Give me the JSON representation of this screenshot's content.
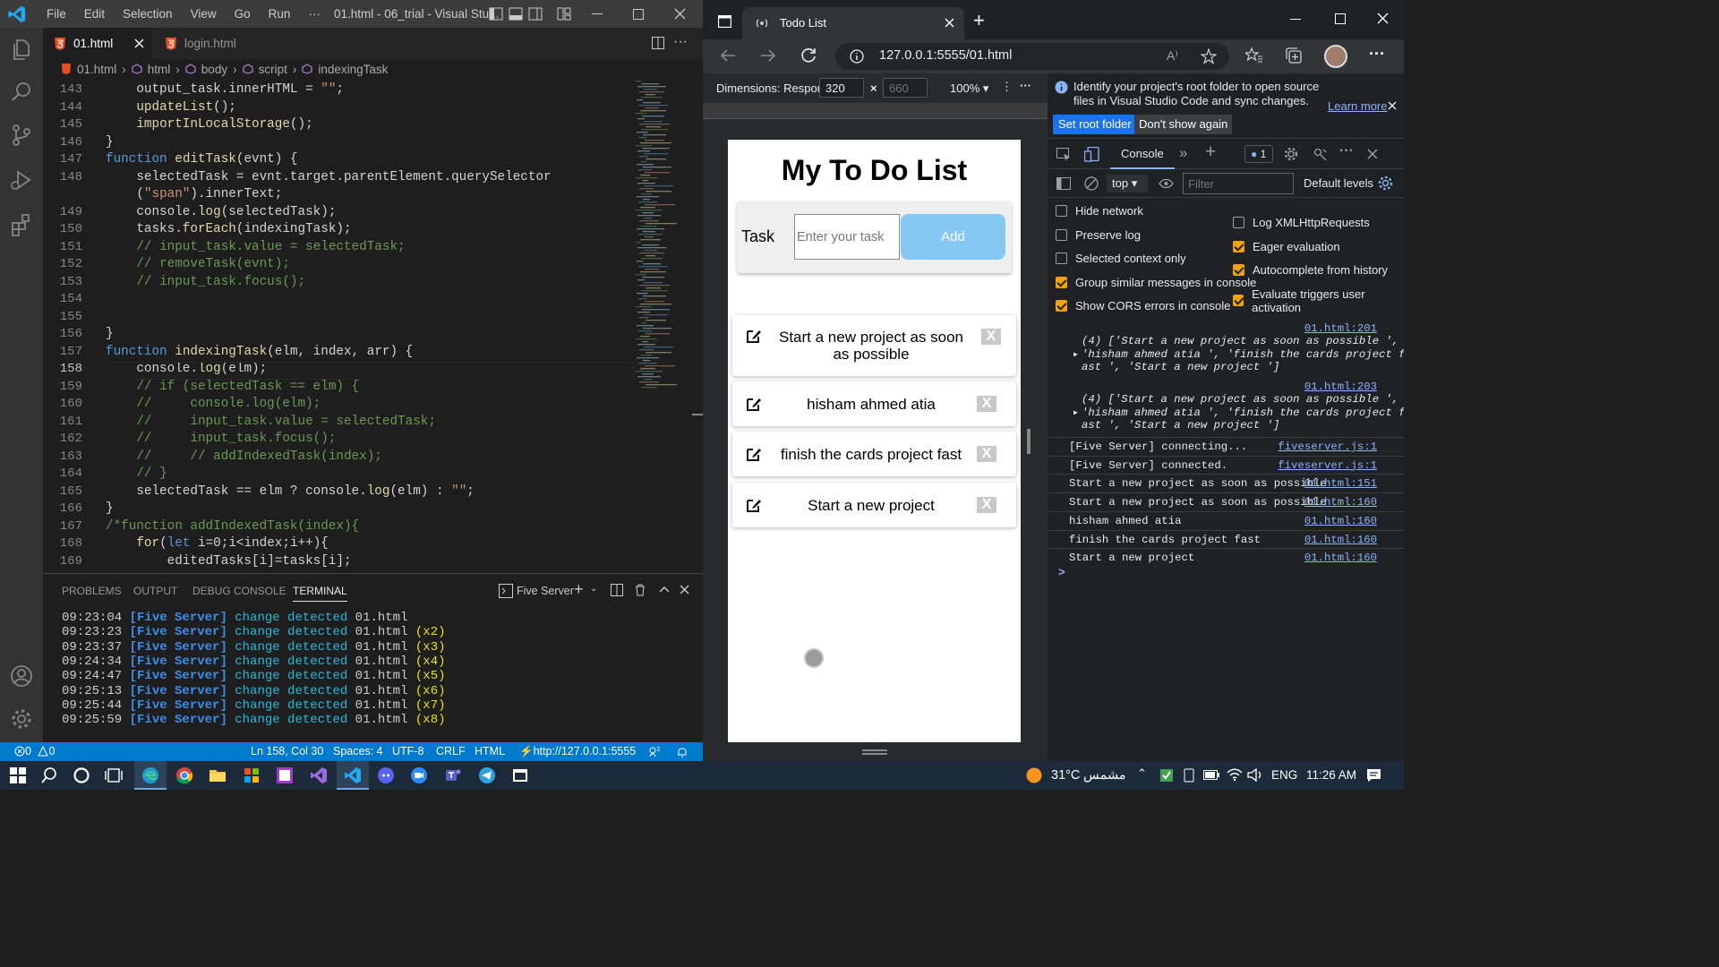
{
  "vscode": {
    "menu": [
      "File",
      "Edit",
      "Selection",
      "View",
      "Go",
      "Run",
      "···"
    ],
    "title": "01.html - 06_trial - Visual Stu...",
    "tabs": [
      {
        "label": "01.html",
        "active": true
      },
      {
        "label": "login.html",
        "active": false
      }
    ],
    "breadcrumb": [
      "01.html",
      "html",
      "body",
      "script",
      "indexingTask"
    ],
    "line_numbers": [
      "143",
      "144",
      "145",
      "146",
      "147",
      "148",
      "",
      "149",
      "150",
      "151",
      "152",
      "153",
      "154",
      "155",
      "156",
      "157",
      "158",
      "159",
      "160",
      "161",
      "162",
      "163",
      "164",
      "165",
      "166",
      "167",
      "168",
      "169"
    ],
    "code": [
      "    output_task.innerHTML = \"\";",
      "    updateList();",
      "    importInLocalStorage();",
      "}",
      "function editTask(evnt) {",
      "    selectedTask = evnt.target.parentElement.querySelector",
      "    (\"span\").innerText;",
      "    console.log(selectedTask);",
      "    tasks.forEach(indexingTask);",
      "    // input_task.value = selectedTask;",
      "    // removeTask(evnt);",
      "    // input_task.focus();",
      "",
      "",
      "}",
      "function indexingTask(elm, index, arr) {",
      "    console.log(elm);",
      "    // if (selectedTask == elm) {",
      "    //     console.log(elm);",
      "    //     input_task.value = selectedTask;",
      "    //     input_task.focus();",
      "    //     // addIndexedTask(index);",
      "    // }",
      "    selectedTask == elm ? console.log(elm) : \"\";",
      "}",
      "/*function addIndexedTask(index){",
      "    for(let i=0;i<index;i++){",
      "        editedTasks[i]=tasks[i];"
    ],
    "panel_tabs": [
      "PROBLEMS",
      "OUTPUT",
      "DEBUG CONSOLE",
      "TERMINAL"
    ],
    "panel_server": "Five Server",
    "terminal": [
      {
        "time": "09:23:04",
        "tag": "[Five Server]",
        "msg": "change detected",
        "file": "01.html",
        "count": ""
      },
      {
        "time": "09:23:23",
        "tag": "[Five Server]",
        "msg": "change detected",
        "file": "01.html",
        "count": "(x2)"
      },
      {
        "time": "09:23:37",
        "tag": "[Five Server]",
        "msg": "change detected",
        "file": "01.html",
        "count": "(x3)"
      },
      {
        "time": "09:24:34",
        "tag": "[Five Server]",
        "msg": "change detected",
        "file": "01.html",
        "count": "(x4)"
      },
      {
        "time": "09:24:47",
        "tag": "[Five Server]",
        "msg": "change detected",
        "file": "01.html",
        "count": "(x5)"
      },
      {
        "time": "09:25:13",
        "tag": "[Five Server]",
        "msg": "change detected",
        "file": "01.html",
        "count": "(x6)"
      },
      {
        "time": "09:25:44",
        "tag": "[Five Server]",
        "msg": "change detected",
        "file": "01.html",
        "count": "(x7)"
      },
      {
        "time": "09:25:59",
        "tag": "[Five Server]",
        "msg": "change detected",
        "file": "01.html",
        "count": "(x8)"
      }
    ],
    "status": {
      "errors": "0",
      "warnings": "0",
      "position": "Ln 158, Col 30",
      "spaces": "Spaces: 4",
      "encoding": "UTF-8",
      "eol": "CRLF",
      "language": "HTML",
      "server": "http://127.0.0.1:5555"
    }
  },
  "browser": {
    "tab_title": "Todo List",
    "url": "127.0.0.1:5555/01.html",
    "dimensions_label": "Dimensions: Respon",
    "width": "320",
    "height_placeholder": "660",
    "zoom": "100%",
    "page": {
      "title": "My To Do List",
      "task_label": "Task",
      "input_placeholder": "Enter your task",
      "add_label": "Add",
      "delete_label": "X",
      "todos": [
        "Start a new project as soon as possible",
        "hisham ahmed atia",
        "finish the cards project fast",
        "Start a new project"
      ]
    }
  },
  "devtools": {
    "info_text": "Identify your project's root folder to open source files in Visual Studio Code and sync changes.",
    "learn_more": "Learn more",
    "set_root": "Set root folder",
    "dont_show": "Don't show again",
    "console_tab": "Console",
    "issues_count": "1",
    "context": "top",
    "filter_placeholder": "Filter",
    "levels": "Default levels",
    "options_left": [
      {
        "label": "Hide network",
        "checked": false
      },
      {
        "label": "Preserve log",
        "checked": false
      },
      {
        "label": "Selected context only",
        "checked": false
      },
      {
        "label": "Group similar messages in console",
        "checked": true
      },
      {
        "label": "Show CORS errors in console",
        "checked": true
      }
    ],
    "options_right": [
      {
        "label": "Log XMLHttpRequests",
        "checked": false
      },
      {
        "label": "Eager evaluation",
        "checked": true
      },
      {
        "label": "Autocomplete from history",
        "checked": true
      },
      {
        "label": "Evaluate triggers user activation",
        "checked": true
      }
    ],
    "groups": [
      {
        "src": "01.html:201",
        "lines": [
          "(4) ['Start a new project as soon as possible ',",
          "'hisham ahmed atia ', 'finish the cards project f",
          "ast ', 'Start a new project ']"
        ]
      },
      {
        "src": "01.html:203",
        "lines": [
          "(4) ['Start a new project as soon as possible ',",
          "'hisham ahmed atia ', 'finish the cards project f",
          "ast ', 'Start a new project ']"
        ]
      }
    ],
    "logs": [
      {
        "msg": "[Five Server] connecting...",
        "src": "fiveserver.js:1"
      },
      {
        "msg": "[Five Server] connected.",
        "src": "fiveserver.js:1"
      },
      {
        "msg": "Start a new project as soon as possible",
        "src": "01.html:151"
      },
      {
        "msg": "Start a new project as soon as possible",
        "src": "01.html:160"
      },
      {
        "msg": "hisham ahmed atia",
        "src": "01.html:160"
      },
      {
        "msg": "finish the cards project fast",
        "src": "01.html:160"
      },
      {
        "msg": "Start a new project",
        "src": "01.html:160"
      }
    ],
    "prompt": ">"
  },
  "taskbar": {
    "weather": "31°C",
    "weather_text": "مشمس",
    "lang": "ENG",
    "time": "11:26 AM"
  }
}
